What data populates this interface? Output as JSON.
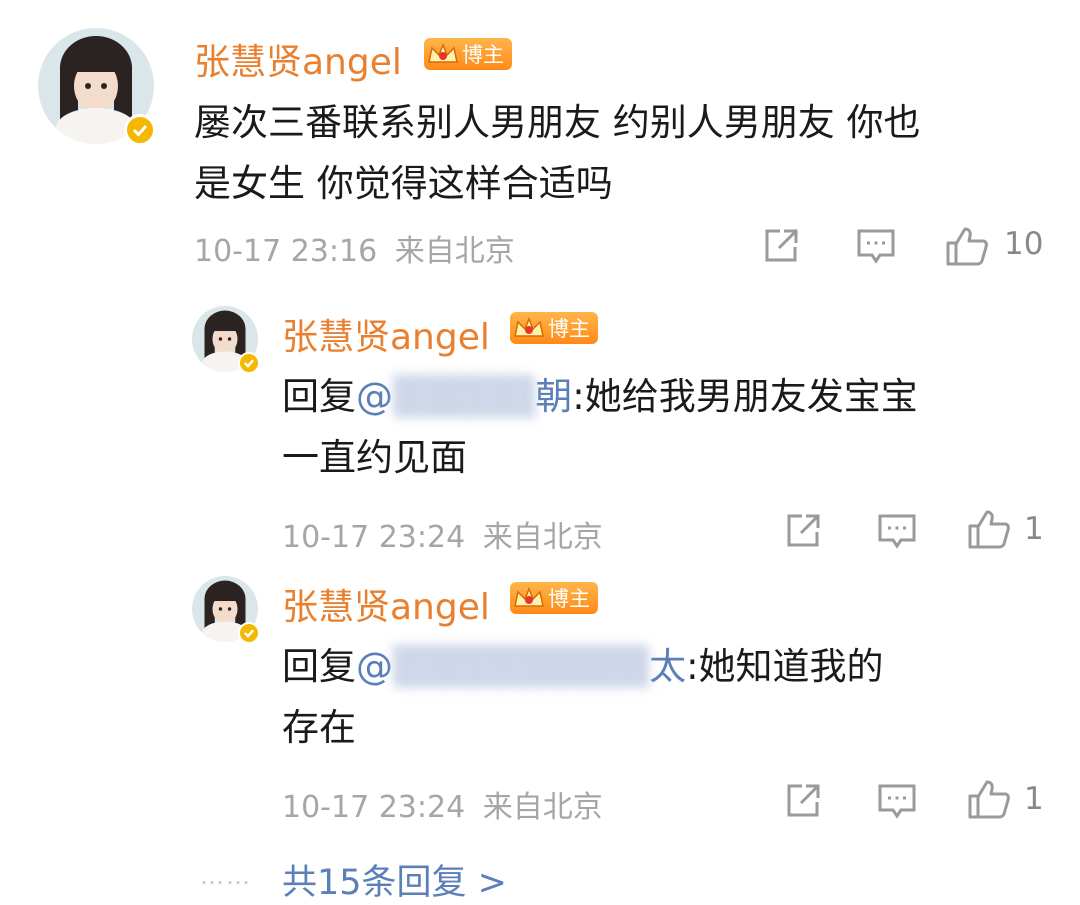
{
  "main_comment": {
    "username": "张慧贤angel",
    "badge_label": "博主",
    "text_line1": "屡次三番联系别人男朋友 约别人男朋友 你也",
    "text_line2": "是女生 你觉得这样合适吗",
    "time": "10-17 23:16",
    "location": "来自北京",
    "like_count": "10",
    "icons": [
      "share-icon",
      "comment-icon",
      "like-icon"
    ]
  },
  "replies": [
    {
      "username": "张慧贤angel",
      "badge_label": "博主",
      "reply_prefix": "回复",
      "mention_visible": "@",
      "mention_tail": "朝",
      "text_line1": ":她给我男朋友发宝宝",
      "text_line2": "一直约见面",
      "time": "10-17 23:24",
      "location": "来自北京",
      "like_count": "1"
    },
    {
      "username": "张慧贤angel",
      "badge_label": "博主",
      "reply_prefix": "回复",
      "mention_visible": "@",
      "mention_tail": "太",
      "text_line1": ":她知道我的",
      "text_line2": "存在",
      "time": "10-17 23:24",
      "location": "来自北京",
      "like_count": "1"
    }
  ],
  "footer": {
    "dots": "……",
    "more_replies": "共15条回复 >"
  },
  "colors": {
    "username": "#e88030",
    "mention": "#5b7fb8",
    "meta": "#a6a6a6",
    "verified": "#f5b800"
  }
}
